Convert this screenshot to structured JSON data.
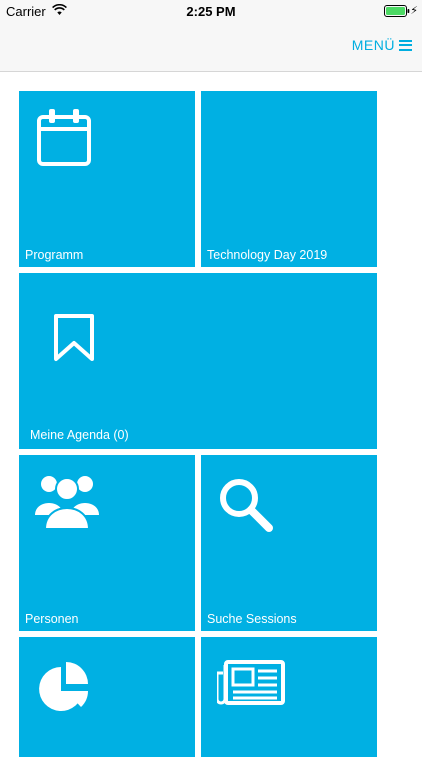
{
  "status": {
    "carrier": "Carrier",
    "time": "2:25 PM"
  },
  "nav": {
    "menu_label": "MENÜ"
  },
  "tiles": [
    {
      "label": "Programm",
      "icon": "calendar-icon"
    },
    {
      "label": "Technology Day 2019"
    },
    {
      "label": "Meine Agenda (0)",
      "icon": "bookmark-icon"
    },
    {
      "label": "Personen",
      "icon": "people-icon"
    },
    {
      "label": "Suche Sessions",
      "icon": "search-icon"
    },
    {
      "label": "",
      "icon": "pie-chart-icon"
    },
    {
      "label": "",
      "icon": "newspaper-icon"
    }
  ],
  "colors": {
    "accent": "#00aee0",
    "tile": "#00b0e3"
  }
}
